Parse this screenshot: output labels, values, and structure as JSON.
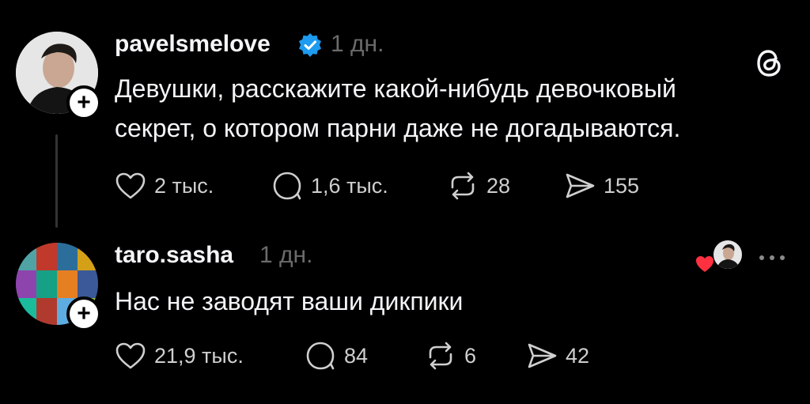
{
  "post1": {
    "username": "pavelsmelove",
    "time": "1 дн.",
    "text_line1": "Девушки, расскажите какой-нибудь девочковый",
    "text_line2": "секрет, о котором парни даже не догадываются.",
    "likes": "2 тыс.",
    "comments": "1,6 тыс.",
    "reposts": "28",
    "shares": "155"
  },
  "post2": {
    "username": "taro.sasha",
    "time": "1 дн.",
    "text": "Нас не заводят ваши дикпики",
    "likes": "21,9 тыс.",
    "comments": "84",
    "reposts": "6",
    "shares": "42"
  },
  "icons": {
    "verified": "verified-badge-icon",
    "threads_logo": "threads-logo-icon",
    "like": "heart-icon",
    "comment": "comment-icon",
    "repost": "repost-icon",
    "share": "share-icon",
    "more": "more-icon"
  },
  "colors": {
    "background": "#000000",
    "verified": "#1d9bf0",
    "liked_heart": "#ff3040",
    "muted_text": "#6b6b6b"
  }
}
